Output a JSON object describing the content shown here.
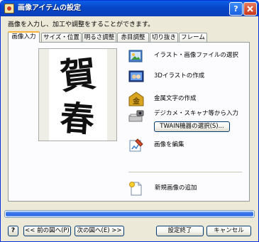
{
  "window": {
    "title": "画像アイテムの設定",
    "help": "?"
  },
  "instruction": "画像を入力し、加工や調整をすることができます。",
  "tabs": [
    "画像入力",
    "サイズ・位置",
    "明るさ調整",
    "赤目調整",
    "切り抜き",
    "フレーム"
  ],
  "preview": {
    "text_top": "賀",
    "text_bottom": "春"
  },
  "actions": [
    {
      "label": "イラスト・画像ファイルの選択",
      "icon": "image-folder-icon"
    },
    {
      "label": "3Dイラストの作成",
      "icon": "3d-illustration-icon"
    },
    {
      "label": "金属文字の作成",
      "icon": "metal-text-icon"
    },
    {
      "label": "デジカメ・スキャナ等から入力",
      "icon": "scanner-camera-icon"
    },
    {
      "label": "画像を編集",
      "icon": "edit-image-icon"
    },
    {
      "label": "新規画像の追加",
      "icon": "new-image-icon"
    }
  ],
  "twain_button": "TWAIN機器の選択(S)...",
  "progress": 1.0,
  "footer": {
    "help": "?",
    "prev": "<< 前の図へ(P)",
    "next": "次の図へ(E) >>",
    "finish": "設定終了",
    "cancel": "キャンセル"
  }
}
